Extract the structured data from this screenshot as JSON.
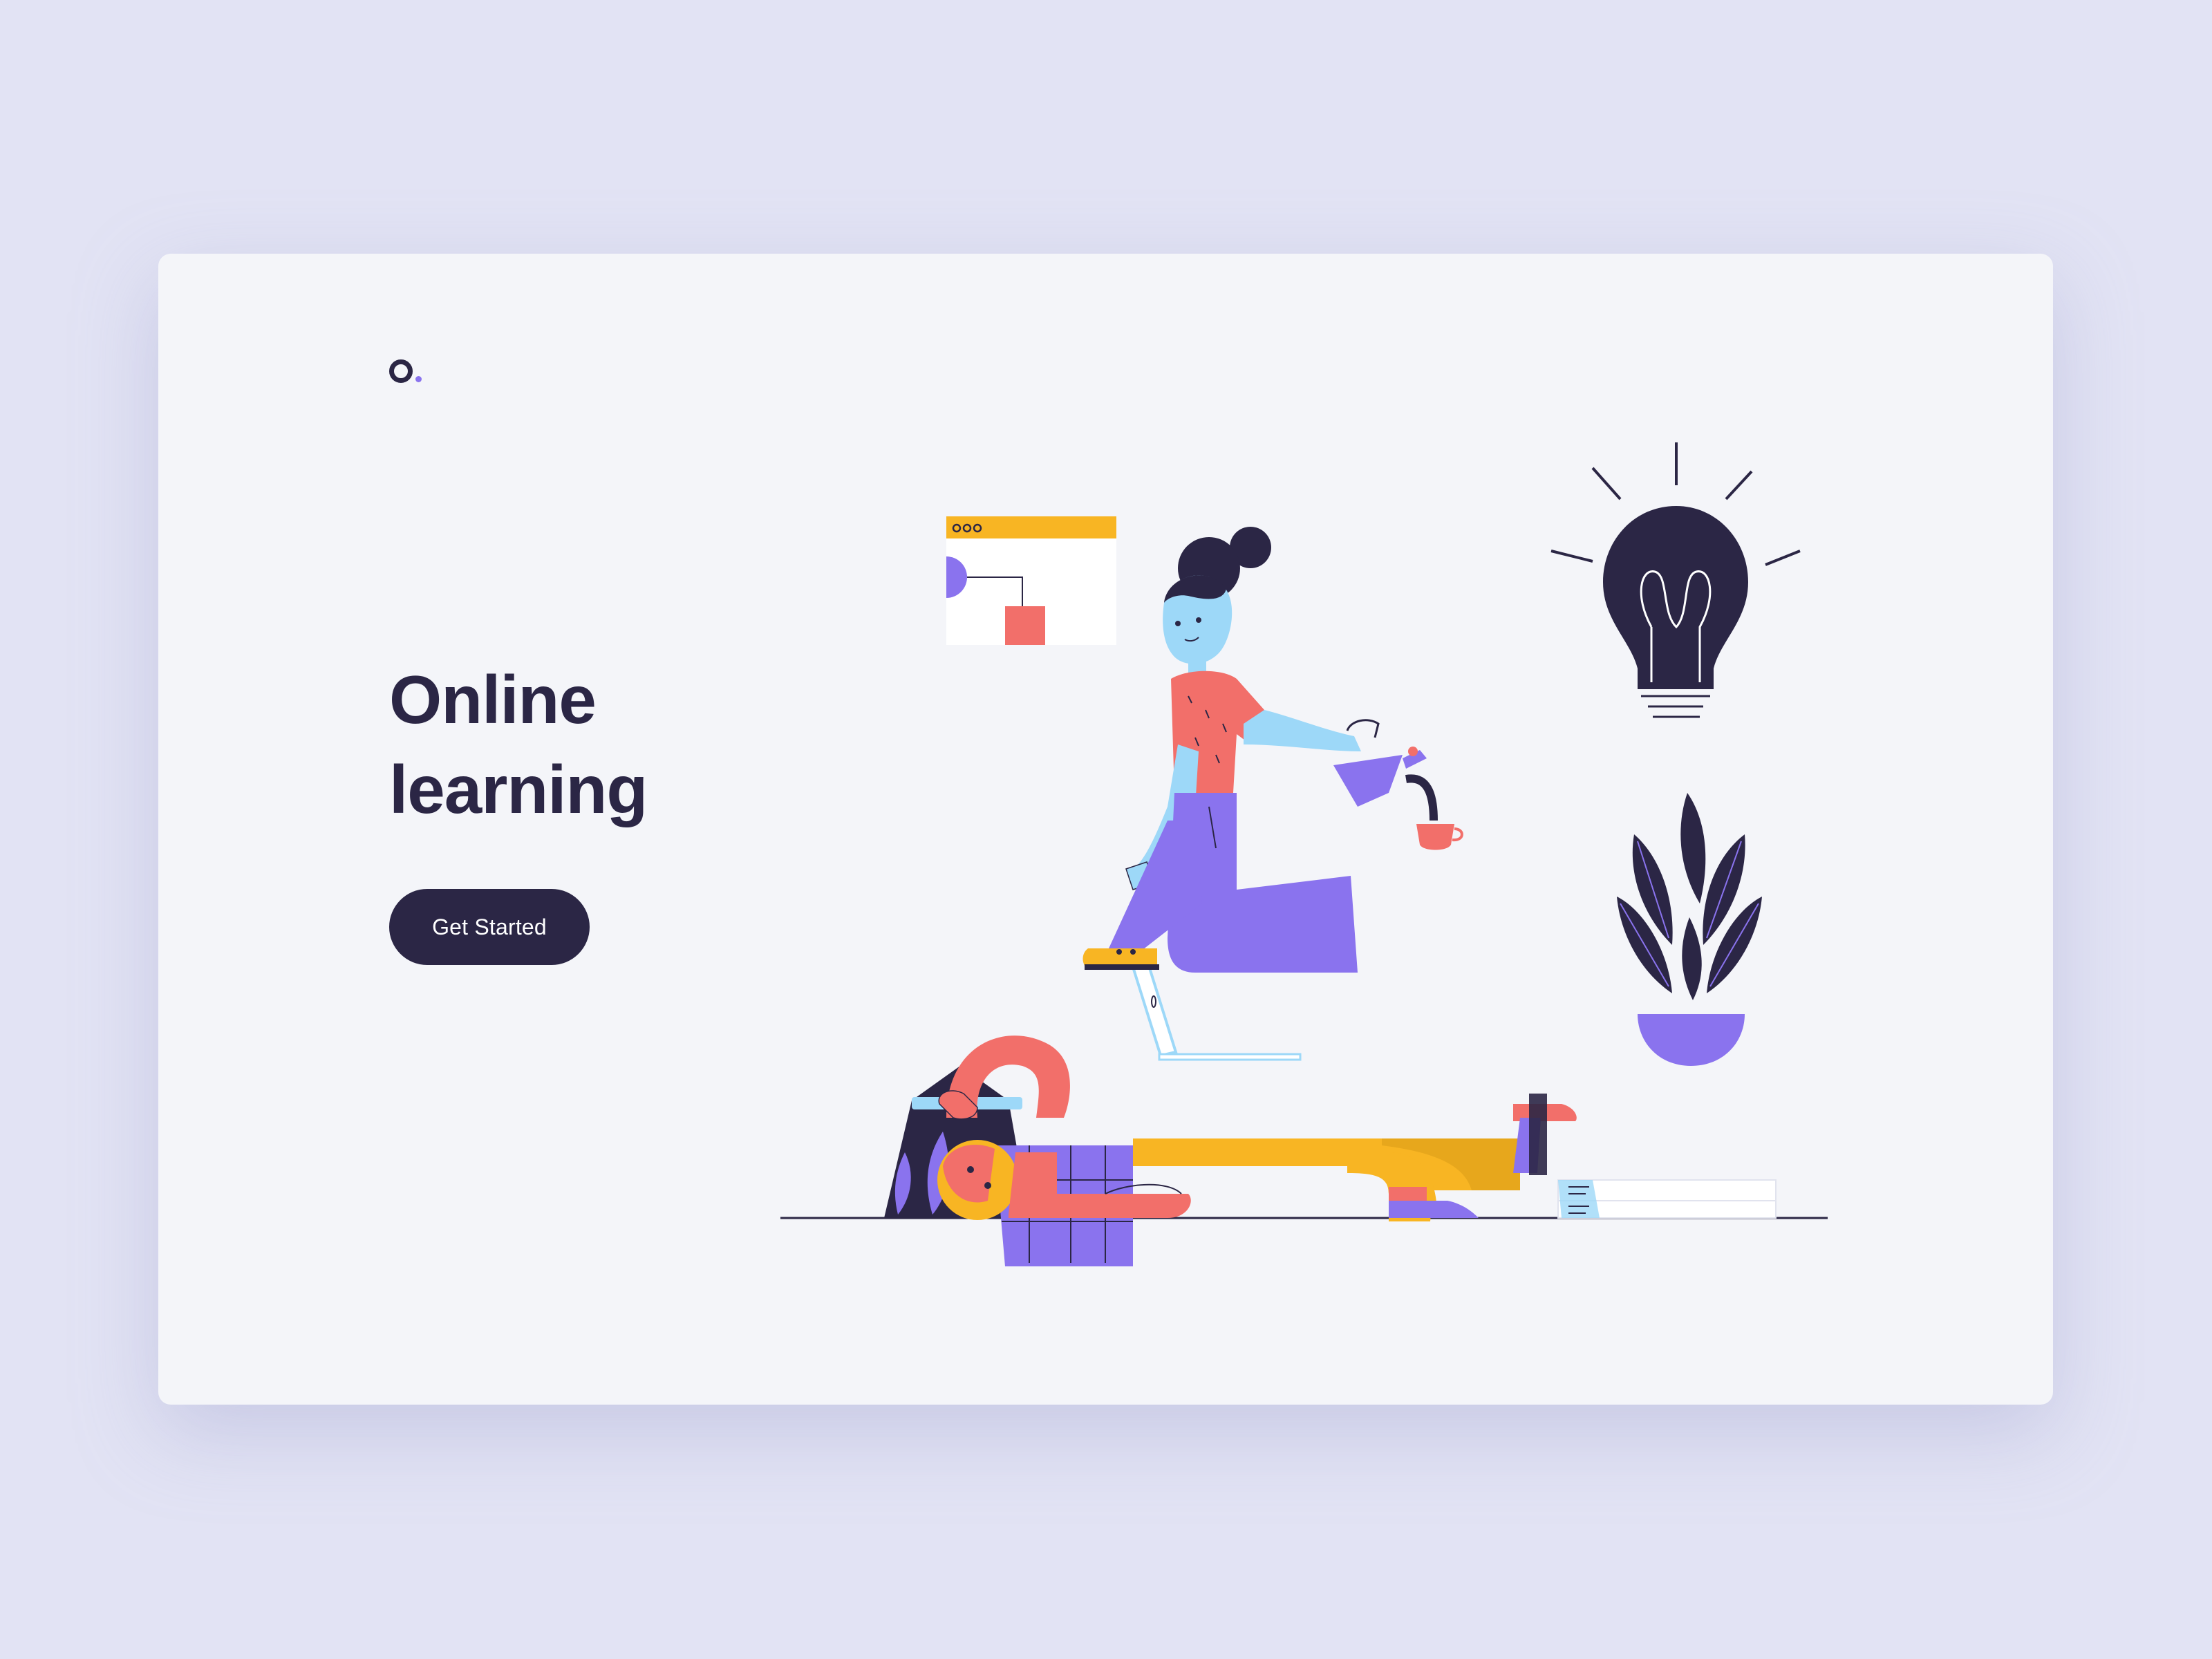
{
  "brand": {
    "logo_icon": "circle-dot-logo-icon",
    "dark": "#2b2645",
    "accent": "#8a73ee"
  },
  "hero": {
    "title_line1": "Online",
    "title_line2": "learning",
    "cta_label": "Get Started"
  },
  "colors": {
    "page_background": "#e2e3f4",
    "card_background": "#f4f5f9",
    "button_background": "#2b2645",
    "coral": "#f26f6a",
    "yellow": "#f8b523",
    "purple": "#8a73ee",
    "skin_blue": "#9dd8f8"
  },
  "illustration": {
    "icons": [
      "browser-window-icon",
      "laptop-icon",
      "lightbulb-icon",
      "plant-icon",
      "teapot-icon",
      "cup-icon",
      "books-icon"
    ]
  }
}
